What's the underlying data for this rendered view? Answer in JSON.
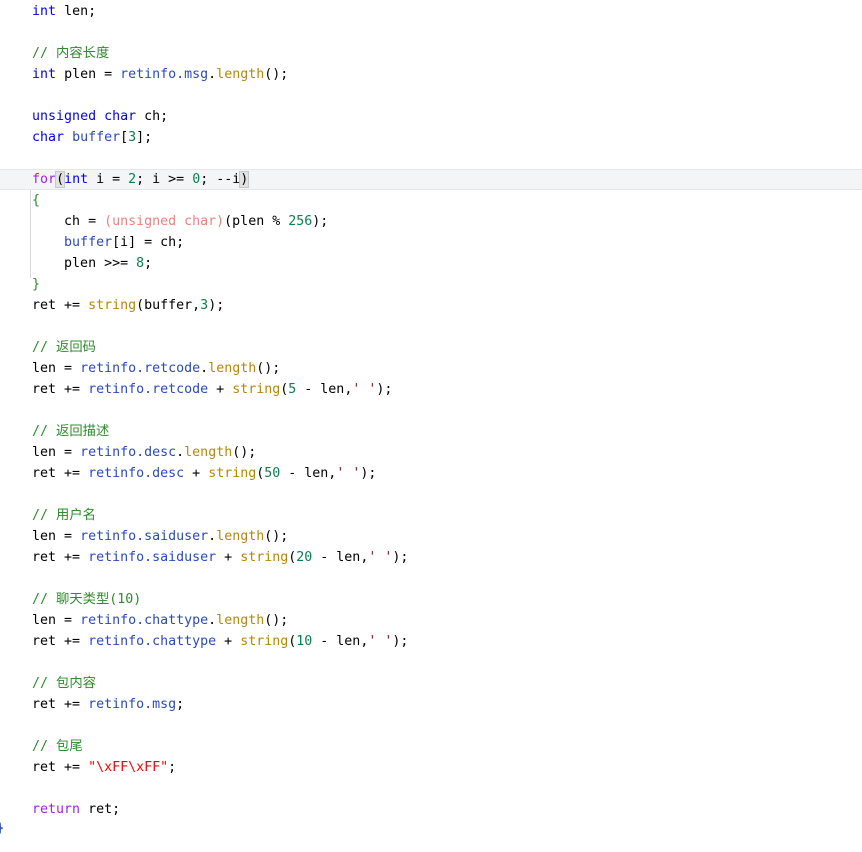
{
  "editor": {
    "language": "C++",
    "background_color": "#ffffff",
    "current_line_highlight_color": "#f4f5f7",
    "indent_guide_color": "#d9d9d9",
    "font_size_px": 13,
    "line_height_px": 21,
    "colors": {
      "keyword": "#0000ff",
      "control_keyword": "#a020f0",
      "comment": "#2e8b2e",
      "number": "#0a7f4e",
      "member": "#2b49c6",
      "function": "#b8860b",
      "string": "#ff0000",
      "char_literal": "#8b1a1a",
      "cast": "#ee8080",
      "brace": "#2e8b2e",
      "plain": "#000000"
    }
  },
  "code": {
    "lines": [
      {
        "n": 1,
        "indent": 1,
        "current": false,
        "text": "int len;"
      },
      {
        "n": 2,
        "indent": 0,
        "current": false,
        "text": ""
      },
      {
        "n": 3,
        "indent": 1,
        "current": false,
        "text": "// 内容长度"
      },
      {
        "n": 4,
        "indent": 1,
        "current": false,
        "text": "int plen = retinfo.msg.length();"
      },
      {
        "n": 5,
        "indent": 0,
        "current": false,
        "text": ""
      },
      {
        "n": 6,
        "indent": 1,
        "current": false,
        "text": "unsigned char ch;"
      },
      {
        "n": 7,
        "indent": 1,
        "current": false,
        "text": "char buffer[3];"
      },
      {
        "n": 8,
        "indent": 0,
        "current": false,
        "text": ""
      },
      {
        "n": 9,
        "indent": 1,
        "current": true,
        "text": "for(int i = 2; i >= 0; --i)"
      },
      {
        "n": 10,
        "indent": 1,
        "current": false,
        "text": "{"
      },
      {
        "n": 11,
        "indent": 2,
        "current": false,
        "text": "ch = (unsigned char)(plen % 256);"
      },
      {
        "n": 12,
        "indent": 2,
        "current": false,
        "text": "buffer[i] = ch;"
      },
      {
        "n": 13,
        "indent": 2,
        "current": false,
        "text": "plen >>= 8;"
      },
      {
        "n": 14,
        "indent": 1,
        "current": false,
        "text": "}"
      },
      {
        "n": 15,
        "indent": 1,
        "current": false,
        "text": "ret += string(buffer,3);"
      },
      {
        "n": 16,
        "indent": 0,
        "current": false,
        "text": ""
      },
      {
        "n": 17,
        "indent": 1,
        "current": false,
        "text": "// 返回码"
      },
      {
        "n": 18,
        "indent": 1,
        "current": false,
        "text": "len = retinfo.retcode.length();"
      },
      {
        "n": 19,
        "indent": 1,
        "current": false,
        "text": "ret += retinfo.retcode + string(5 - len,' ');"
      },
      {
        "n": 20,
        "indent": 0,
        "current": false,
        "text": ""
      },
      {
        "n": 21,
        "indent": 1,
        "current": false,
        "text": "// 返回描述"
      },
      {
        "n": 22,
        "indent": 1,
        "current": false,
        "text": "len = retinfo.desc.length();"
      },
      {
        "n": 23,
        "indent": 1,
        "current": false,
        "text": "ret += retinfo.desc + string(50 - len,' ');"
      },
      {
        "n": 24,
        "indent": 0,
        "current": false,
        "text": ""
      },
      {
        "n": 25,
        "indent": 1,
        "current": false,
        "text": "// 用户名"
      },
      {
        "n": 26,
        "indent": 1,
        "current": false,
        "text": "len = retinfo.saiduser.length();"
      },
      {
        "n": 27,
        "indent": 1,
        "current": false,
        "text": "ret += retinfo.saiduser + string(20 - len,' ');"
      },
      {
        "n": 28,
        "indent": 0,
        "current": false,
        "text": ""
      },
      {
        "n": 29,
        "indent": 1,
        "current": false,
        "text": "// 聊天类型(10)"
      },
      {
        "n": 30,
        "indent": 1,
        "current": false,
        "text": "len = retinfo.chattype.length();"
      },
      {
        "n": 31,
        "indent": 1,
        "current": false,
        "text": "ret += retinfo.chattype + string(10 - len,' ');"
      },
      {
        "n": 32,
        "indent": 0,
        "current": false,
        "text": ""
      },
      {
        "n": 33,
        "indent": 1,
        "current": false,
        "text": "// 包内容"
      },
      {
        "n": 34,
        "indent": 1,
        "current": false,
        "text": "ret += retinfo.msg;"
      },
      {
        "n": 35,
        "indent": 0,
        "current": false,
        "text": ""
      },
      {
        "n": 36,
        "indent": 1,
        "current": false,
        "text": "// 包尾"
      },
      {
        "n": 37,
        "indent": 1,
        "current": false,
        "text": "ret += \"\\xFF\\xFF\";"
      },
      {
        "n": 38,
        "indent": 0,
        "current": false,
        "text": ""
      },
      {
        "n": 39,
        "indent": 1,
        "current": false,
        "text": "return ret;"
      },
      {
        "n": 40,
        "indent": 0,
        "current": false,
        "text": ""
      },
      {
        "n": 41,
        "indent": 0,
        "current": false,
        "text": "}"
      }
    ],
    "tokens": {
      "l1": {
        "kw": "int",
        "rest": " len;"
      },
      "l3": {
        "comment": "// 内容长度"
      },
      "l4": {
        "kw": "int",
        "p1": " plen = ",
        "member": "retinfo.msg",
        "dot": ".",
        "fn": "length",
        "p2": "();"
      },
      "l6": {
        "kw": "unsigned char",
        "rest": " ch;"
      },
      "l7": {
        "kw": "char",
        "p1": " ",
        "member": "buffer",
        "b1": "[",
        "num": "3",
        "b2": "];"
      },
      "l9": {
        "kw2": "for",
        "paren_open": "(",
        "kw": "int",
        "p1": " i = ",
        "num1": "2",
        "p2": "; i >= ",
        "num2": "0",
        "p3": "; --i",
        "paren_close": ")"
      },
      "l10": {
        "brace": "{"
      },
      "l11": {
        "p1": "ch = ",
        "cast": "(unsigned char)",
        "p2": "(plen % ",
        "num": "256",
        "p3": ");"
      },
      "l12": {
        "member": "buffer",
        "p1": "[i] = ch;"
      },
      "l13": {
        "p1": "plen >>= ",
        "num": "8",
        "p2": ";"
      },
      "l14": {
        "brace": "}"
      },
      "l15": {
        "p1": "ret += ",
        "fn": "string",
        "p2": "(buffer,",
        "num": "3",
        "p3": ");"
      },
      "l17": {
        "comment": "// 返回码"
      },
      "l18": {
        "p1": "len = ",
        "member": "retinfo.retcode",
        "dot": ".",
        "fn": "length",
        "p2": "();"
      },
      "l19": {
        "p1": "ret += ",
        "member": "retinfo.retcode",
        "p2": " + ",
        "fn": "string",
        "p3": "(",
        "num": "5",
        "p4": " - len,",
        "chr": "' '",
        "p5": ");"
      },
      "l21": {
        "comment": "// 返回描述"
      },
      "l22": {
        "p1": "len = ",
        "member": "retinfo.desc",
        "dot": ".",
        "fn": "length",
        "p2": "();"
      },
      "l23": {
        "p1": "ret += ",
        "member": "retinfo.desc",
        "p2": " + ",
        "fn": "string",
        "p3": "(",
        "num": "50",
        "p4": " - len,",
        "chr": "' '",
        "p5": ");"
      },
      "l25": {
        "comment": "// 用户名"
      },
      "l26": {
        "p1": "len = ",
        "member": "retinfo.saiduser",
        "dot": ".",
        "fn": "length",
        "p2": "();"
      },
      "l27": {
        "p1": "ret += ",
        "member": "retinfo.saiduser",
        "p2": " + ",
        "fn": "string",
        "p3": "(",
        "num": "20",
        "p4": " - len,",
        "chr": "' '",
        "p5": ");"
      },
      "l29": {
        "comment": "// 聊天类型(10)"
      },
      "l30": {
        "p1": "len = ",
        "member": "retinfo.chattype",
        "dot": ".",
        "fn": "length",
        "p2": "();"
      },
      "l31": {
        "p1": "ret += ",
        "member": "retinfo.chattype",
        "p2": " + ",
        "fn": "string",
        "p3": "(",
        "num": "10",
        "p4": " - len,",
        "chr": "' '",
        "p5": ");"
      },
      "l33": {
        "comment": "// 包内容"
      },
      "l34": {
        "p1": "ret += ",
        "member": "retinfo.msg",
        "p2": ";"
      },
      "l36": {
        "comment": "// 包尾"
      },
      "l37": {
        "p1": "ret += ",
        "str": "\"\\xFF\\xFF\"",
        "p2": ";"
      },
      "l39": {
        "kw2": "return",
        "rest": " ret;"
      },
      "l41": {
        "brace_blue": "}"
      }
    }
  }
}
